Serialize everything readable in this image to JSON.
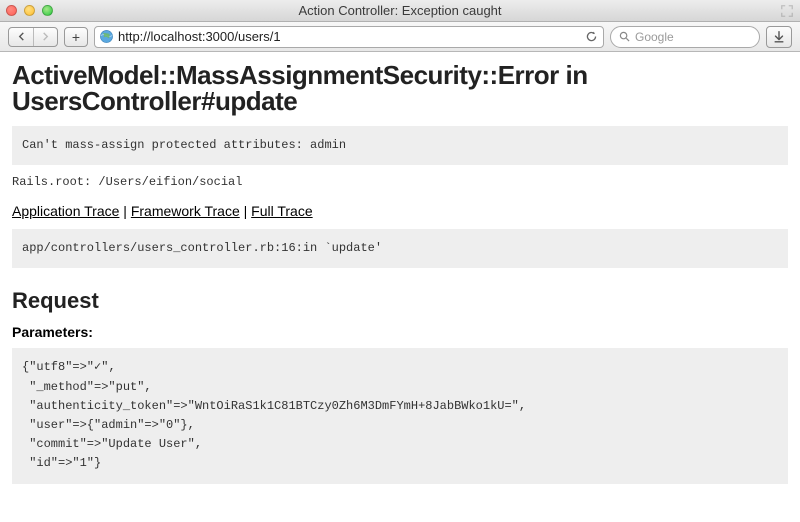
{
  "window": {
    "title": "Action Controller: Exception caught"
  },
  "toolbar": {
    "url": "http://localhost:3000/users/1",
    "search_placeholder": "Google"
  },
  "error": {
    "heading": "ActiveModel::MassAssignmentSecurity::Error in UsersController#update",
    "message": "Can't mass-assign protected attributes: admin",
    "rails_root": "Rails.root: /Users/eifion/social",
    "traces": {
      "app": "Application Trace",
      "framework": "Framework Trace",
      "full": "Full Trace",
      "sep1": " | ",
      "sep2": " | "
    },
    "app_trace": "app/controllers/users_controller.rb:16:in `update'",
    "request_heading": "Request",
    "parameters_label": "Parameters",
    "parameters_block": "{\"utf8\"=>\"✓\",\n \"_method\"=>\"put\",\n \"authenticity_token\"=>\"WntOiRaS1k1C81BTCzy0Zh6M3DmFYmH+8JabBWko1kU=\",\n \"user\"=>{\"admin\"=>\"0\"},\n \"commit\"=>\"Update User\",\n \"id\"=>\"1\"}"
  }
}
